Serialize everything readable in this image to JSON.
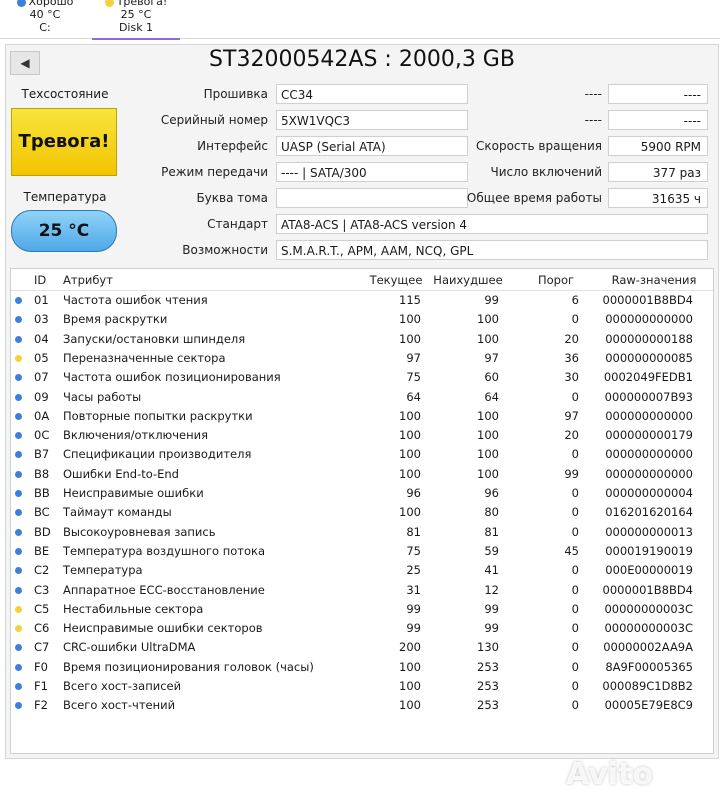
{
  "tabs": [
    {
      "status": "Хорошо",
      "temp": "40 °C",
      "name": "C:",
      "color": "#3f7fdc"
    },
    {
      "status": "Тревога!",
      "temp": "25 °C",
      "name": "Disk 1",
      "color": "#f3d23a"
    }
  ],
  "header": {
    "back": "◀",
    "title": "ST32000542AS : 2000,3 GB"
  },
  "health": {
    "label": "Техсостояние",
    "value": "Тревога!",
    "temp_label": "Температура",
    "temp_value": "25 °C"
  },
  "info": {
    "firmware_label": "Прошивка",
    "firmware": "CC34",
    "serial_label": "Серийный номер",
    "serial": "5XW1VQC3",
    "interface_label": "Интерфейс",
    "interface": "UASP (Serial ATA)",
    "mode_label": "Режим передачи",
    "mode": "---- | SATA/300",
    "letter_label": "Буква тома",
    "letter": "",
    "standard_label": "Стандарт",
    "standard": "ATA8-ACS | ATA8-ACS version 4",
    "features_label": "Возможности",
    "features": "S.M.A.R.T., APM, AAM, NCQ, GPL",
    "r1_label": "----",
    "r1": "----",
    "r2_label": "----",
    "r2": "----",
    "rpm_label": "Скорость вращения",
    "rpm": "5900 RPM",
    "power_count_label": "Число включений",
    "power_count": "377 раз",
    "power_hours_label": "Общее время работы",
    "power_hours": "31635 ч"
  },
  "table": {
    "headers": {
      "id": "ID",
      "attr": "Атрибут",
      "cur": "Текущее",
      "worst": "Наихудшее",
      "thr": "Порог",
      "raw": "Raw-значения"
    },
    "rows": [
      {
        "s": "good",
        "id": "01",
        "attr": "Частота ошибок чтения",
        "cur": "115",
        "worst": "99",
        "thr": "6",
        "raw": "0000001B8BD4"
      },
      {
        "s": "good",
        "id": "03",
        "attr": "Время раскрутки",
        "cur": "100",
        "worst": "100",
        "thr": "0",
        "raw": "000000000000"
      },
      {
        "s": "good",
        "id": "04",
        "attr": "Запуски/остановки шпинделя",
        "cur": "100",
        "worst": "100",
        "thr": "20",
        "raw": "000000000188"
      },
      {
        "s": "warn",
        "id": "05",
        "attr": "Переназначенные сектора",
        "cur": "97",
        "worst": "97",
        "thr": "36",
        "raw": "000000000085"
      },
      {
        "s": "good",
        "id": "07",
        "attr": "Частота ошибок позиционирования",
        "cur": "75",
        "worst": "60",
        "thr": "30",
        "raw": "0002049FEDB1"
      },
      {
        "s": "good",
        "id": "09",
        "attr": "Часы работы",
        "cur": "64",
        "worst": "64",
        "thr": "0",
        "raw": "000000007B93"
      },
      {
        "s": "good",
        "id": "0A",
        "attr": "Повторные попытки раскрутки",
        "cur": "100",
        "worst": "100",
        "thr": "97",
        "raw": "000000000000"
      },
      {
        "s": "good",
        "id": "0C",
        "attr": "Включения/отключения",
        "cur": "100",
        "worst": "100",
        "thr": "20",
        "raw": "000000000179"
      },
      {
        "s": "good",
        "id": "B7",
        "attr": "Спецификации производителя",
        "cur": "100",
        "worst": "100",
        "thr": "0",
        "raw": "000000000000"
      },
      {
        "s": "good",
        "id": "B8",
        "attr": "Ошибки End-to-End",
        "cur": "100",
        "worst": "100",
        "thr": "99",
        "raw": "000000000000"
      },
      {
        "s": "good",
        "id": "BB",
        "attr": "Неисправимые ошибки",
        "cur": "96",
        "worst": "96",
        "thr": "0",
        "raw": "000000000004"
      },
      {
        "s": "good",
        "id": "BC",
        "attr": "Таймаут команды",
        "cur": "100",
        "worst": "80",
        "thr": "0",
        "raw": "016201620164"
      },
      {
        "s": "good",
        "id": "BD",
        "attr": "Высокоуровневая запись",
        "cur": "81",
        "worst": "81",
        "thr": "0",
        "raw": "000000000013"
      },
      {
        "s": "good",
        "id": "BE",
        "attr": "Температура воздушного потока",
        "cur": "75",
        "worst": "59",
        "thr": "45",
        "raw": "000019190019"
      },
      {
        "s": "good",
        "id": "C2",
        "attr": "Температура",
        "cur": "25",
        "worst": "41",
        "thr": "0",
        "raw": "000E00000019"
      },
      {
        "s": "good",
        "id": "C3",
        "attr": "Аппаратное ECC-восстановление",
        "cur": "31",
        "worst": "12",
        "thr": "0",
        "raw": "0000001B8BD4"
      },
      {
        "s": "warn",
        "id": "C5",
        "attr": "Нестабильные сектора",
        "cur": "99",
        "worst": "99",
        "thr": "0",
        "raw": "00000000003C"
      },
      {
        "s": "warn",
        "id": "C6",
        "attr": "Неисправимые ошибки секторов",
        "cur": "99",
        "worst": "99",
        "thr": "0",
        "raw": "00000000003C"
      },
      {
        "s": "good",
        "id": "C7",
        "attr": "CRC-ошибки UltraDMA",
        "cur": "200",
        "worst": "130",
        "thr": "0",
        "raw": "00000002AA9A"
      },
      {
        "s": "good",
        "id": "F0",
        "attr": "Время позиционирования головок (часы)",
        "cur": "100",
        "worst": "253",
        "thr": "0",
        "raw": "8A9F00005365"
      },
      {
        "s": "good",
        "id": "F1",
        "attr": "Всего хост-записей",
        "cur": "100",
        "worst": "253",
        "thr": "0",
        "raw": "000089C1D8B2"
      },
      {
        "s": "good",
        "id": "F2",
        "attr": "Всего хост-чтений",
        "cur": "100",
        "worst": "253",
        "thr": "0",
        "raw": "00005E79E8C9"
      }
    ]
  },
  "watermark": "Avito"
}
